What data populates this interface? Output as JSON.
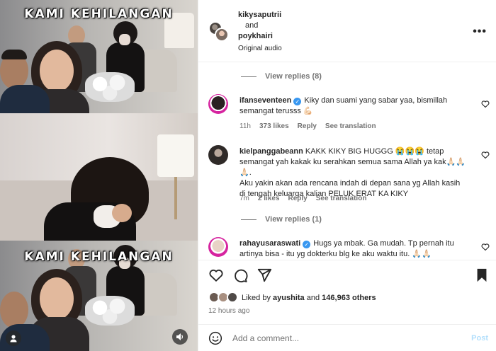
{
  "video": {
    "overlay_title_top": "KAMI KEHILANGAN",
    "overlay_title_mid": "KAMI KEHILANGAN"
  },
  "header": {
    "user1": "kikysaputrii",
    "conjunction": "and",
    "user2": "poykhairi",
    "audio": "Original audio",
    "more_icon": "more-options-icon"
  },
  "comments": {
    "view_replies_top": "View replies (8)",
    "items": [
      {
        "username": "ifanseventeen",
        "verified": true,
        "text_line1": "Kiky dan suami yang sabar yaa, bismillah",
        "text_line2": "semangat terusss 💪🏻",
        "time": "11h",
        "likes": "373 likes",
        "reply": "Reply",
        "translation": "See translation"
      },
      {
        "username": "kielpanggabeann",
        "verified": false,
        "text_line1": "KAKK KIKY BIG HUGGG 😭😭😭 tetap",
        "text_line2": "semangat yah kakak ku serahkan semua sama Allah ya kak🙏🏻🙏🏻🙏🏻.",
        "text_line3": "Aku yakin akan ada rencana indah di depan sana yg Allah kasih",
        "text_line4": "di tengah keluarga kalian PELUK ERAT KA KIKY",
        "time": "7m",
        "likes": "2 likes",
        "reply": "Reply",
        "translation": "See translation",
        "view_replies": "View replies (1)"
      },
      {
        "username": "rahayusaraswati",
        "verified": true,
        "text_line1": "Hugs ya mbak. Ga mudah. Tp pernah itu",
        "text_line2": "artinya bisa - itu yg dokterku blg ke aku waktu itu. 🙏🏻🙏🏻"
      }
    ]
  },
  "actions": {
    "like_icon": "heart-icon",
    "comment_icon": "comment-icon",
    "share_icon": "share-icon",
    "save_icon": "bookmark-icon",
    "liked_by_prefix": "Liked by",
    "liked_by_user": "ayushita",
    "liked_by_and": "and",
    "liked_by_count": "146,963 others",
    "time_ago": "12 hours ago"
  },
  "composer": {
    "placeholder": "Add a comment...",
    "post_label": "Post",
    "emoji_icon": "emoji-icon"
  },
  "colors": {
    "verified": "#3897f0",
    "post_button_disabled": "#b2dffc",
    "meta_text": "#737373"
  }
}
